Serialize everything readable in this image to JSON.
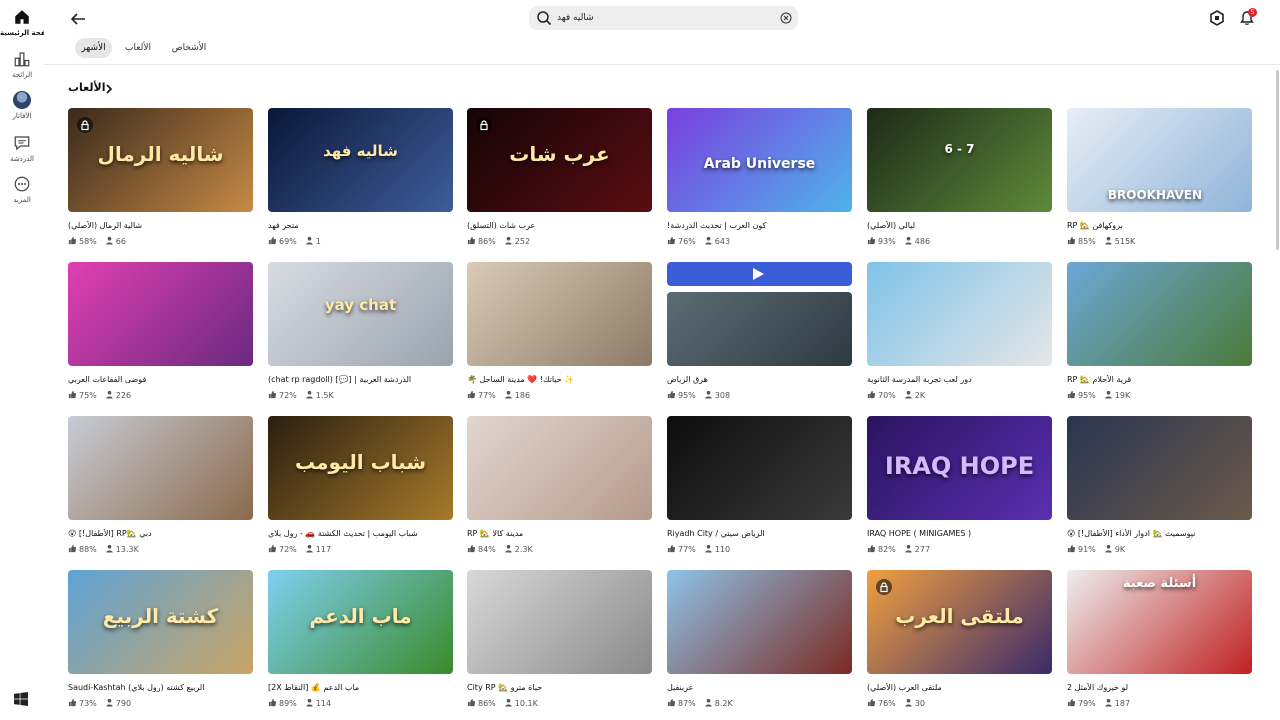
{
  "sidebar": {
    "items": [
      {
        "label": "الصفحة الرئيسية",
        "icon": "home-icon"
      },
      {
        "label": "الرائجة",
        "icon": "charts-icon"
      },
      {
        "label": "الأفاتار",
        "icon": "avatar-icon"
      },
      {
        "label": "الدردشة",
        "icon": "chat-icon"
      },
      {
        "label": "المزيد",
        "icon": "more-icon"
      }
    ]
  },
  "header": {
    "search_value": "شاليه فهد",
    "notification_count": "5"
  },
  "tabs": [
    {
      "label": "الأشهر"
    },
    {
      "label": "الألعاب"
    },
    {
      "label": "الأشخاص"
    }
  ],
  "section": {
    "title": "الألعاب"
  },
  "games": [
    {
      "name": "شالية الرمال (الأصلي)",
      "rating": "58%",
      "players": "66",
      "thumb_text": "شاليه الرمال",
      "c1": "#3a2a1c",
      "c2": "#c78a45",
      "locked": true
    },
    {
      "name": "متجر فهد",
      "rating": "69%",
      "players": "1",
      "thumb_text": "شاليه فهد",
      "c1": "#0a1838",
      "c2": "#3f5d9a",
      "locked": false
    },
    {
      "name": "عرب شات (التسلق)",
      "rating": "86%",
      "players": "252",
      "thumb_text": "عرب شات",
      "c1": "#150406",
      "c2": "#5a0d12",
      "locked": true
    },
    {
      "name": "كون العرب | تحديث الدردشة!",
      "rating": "76%",
      "players": "643",
      "thumb_text": "Arab Universe",
      "c1": "#7a3fe0",
      "c2": "#4fb3e8",
      "locked": false
    },
    {
      "name": "ليالي (الأصلي)",
      "rating": "93%",
      "players": "486",
      "thumb_text": "6 - 7",
      "c1": "#1c2a18",
      "c2": "#5f8a3a",
      "locked": false
    },
    {
      "name": "بروكهافن 🏡 RP",
      "rating": "85%",
      "players": "515K",
      "thumb_text": "BROOKHAVEN",
      "c1": "#e8eef5",
      "c2": "#8fb4d9",
      "locked": false
    },
    {
      "name": "فوضى الفقاعات العربي",
      "rating": "75%",
      "players": "226",
      "thumb_text": "",
      "c1": "#e03fb0",
      "c2": "#6a2a80",
      "locked": false
    },
    {
      "name": "الدردشة العربية | [💬] (chat rp ragdoll)",
      "rating": "72%",
      "players": "1.5K",
      "thumb_text": "yay chat",
      "c1": "#d8dce2",
      "c2": "#9aa3ad",
      "locked": false
    },
    {
      "name": "✨ حياتك! ❤️ مدينة الساحل 🌴",
      "rating": "77%",
      "players": "186",
      "thumb_text": "",
      "c1": "#d9cbb8",
      "c2": "#8c7a66",
      "locked": false
    },
    {
      "name": "هرق الرياض",
      "rating": "95%",
      "players": "308",
      "thumb_text": "",
      "c1": "#5d6b75",
      "c2": "#2d3a40",
      "locked": false
    },
    {
      "name": "دور لعب تجربة المدرسة الثانوية",
      "rating": "70%",
      "players": "2K",
      "thumb_text": "",
      "c1": "#7fc3e8",
      "c2": "#e6e6e6",
      "locked": false
    },
    {
      "name": "قرية الأحلام 🏡 RP",
      "rating": "95%",
      "players": "19K",
      "thumb_text": "",
      "c1": "#6ea7d8",
      "c2": "#4c7a3a",
      "locked": false
    },
    {
      "name": "دبي 🏡RP [الأطفال!] 😮",
      "rating": "88%",
      "players": "13.3K",
      "thumb_text": "",
      "c1": "#c8ccd6",
      "c2": "#8a6a4a",
      "locked": false
    },
    {
      "name": "شباب اليومب | تحديث الكشتة 🚗 - رول بلاي",
      "rating": "72%",
      "players": "117",
      "thumb_text": "شباب اليومب",
      "c1": "#2a1f10",
      "c2": "#a77a2a",
      "locked": false
    },
    {
      "name": "مدينة كالا 🏡 RP",
      "rating": "84%",
      "players": "2.3K",
      "thumb_text": "",
      "c1": "#e2d6cf",
      "c2": "#b59a8c",
      "locked": false
    },
    {
      "name": "الرياض سيتي / Riyadh City",
      "rating": "77%",
      "players": "110",
      "thumb_text": "",
      "c1": "#0d0d0d",
      "c2": "#3a3a3a",
      "locked": false
    },
    {
      "name": "IRAQ HOPE ( MINIGAMES )",
      "rating": "82%",
      "players": "277",
      "thumb_text": "IRAQ HOPE",
      "c1": "#2a1460",
      "c2": "#5a2fb0",
      "locked": false
    },
    {
      "name": "نيوسميث 🏡 ادوار الأداء [الأطفال!] 😮",
      "rating": "91%",
      "players": "9K",
      "thumb_text": "",
      "c1": "#2a3550",
      "c2": "#6a5a4a",
      "locked": false
    },
    {
      "name": "Saudi-Kashtah الربيع كشته (رول بلاي)",
      "rating": "73%",
      "players": "790",
      "thumb_text": "كشتة الربيع",
      "c1": "#5fa3d8",
      "c2": "#c9a464",
      "locked": false
    },
    {
      "name": "ماب الدعم 💰 [النقاط 2X]",
      "rating": "89%",
      "players": "114",
      "thumb_text": "ماب الدعم",
      "c1": "#7fd0f0",
      "c2": "#3a8a2a",
      "locked": false
    },
    {
      "name": "حياة مترو 🏡 City RP",
      "rating": "86%",
      "players": "10.1K",
      "thumb_text": "",
      "c1": "#d8d8d8",
      "c2": "#8a8a8a",
      "locked": false
    },
    {
      "name": "غرينفيل",
      "rating": "87%",
      "players": "8.2K",
      "thumb_text": "",
      "c1": "#8fc3e8",
      "c2": "#7a2a22",
      "locked": false
    },
    {
      "name": "ملتقى العرب (الأصلي)",
      "rating": "76%",
      "players": "30",
      "thumb_text": "ملتقى العرب",
      "c1": "#f0a040",
      "c2": "#3a2a6a",
      "locked": true
    },
    {
      "name": "لو خيروك الأمثل 2",
      "rating": "79%",
      "players": "187",
      "thumb_text": "أسئلة صعبة",
      "c1": "#eeeeee",
      "c2": "#c02020",
      "locked": false
    }
  ]
}
